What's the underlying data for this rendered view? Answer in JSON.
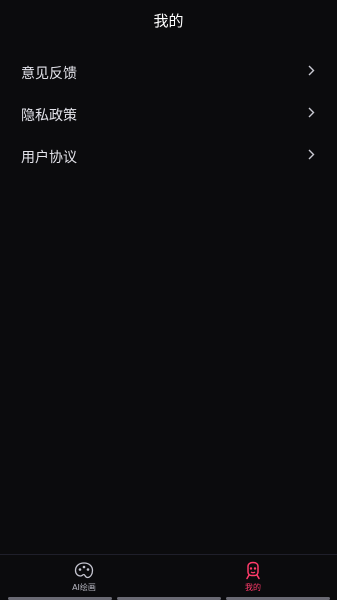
{
  "header": {
    "title": "我的"
  },
  "menu": {
    "items": [
      {
        "label": "意见反馈"
      },
      {
        "label": "隐私政策"
      },
      {
        "label": "用户协议"
      }
    ]
  },
  "tabbar": {
    "tabs": [
      {
        "label": "AI绘画",
        "icon": "palette-icon",
        "active": false
      },
      {
        "label": "我的",
        "icon": "robot-face-icon",
        "active": true
      }
    ]
  },
  "colors": {
    "background": "#0b0b0d",
    "accent": "#ff3b6a"
  }
}
